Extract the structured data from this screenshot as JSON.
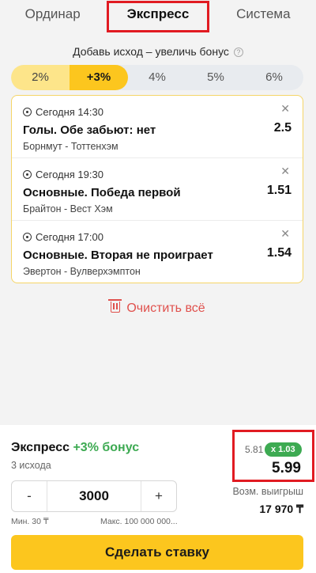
{
  "tabs": [
    "Ординар",
    "Экспресс",
    "Система"
  ],
  "bonus": {
    "title": "Добавь исход – увеличь бонус",
    "info_icon": "?",
    "steps": [
      "2%",
      "+3%",
      "4%",
      "5%",
      "6%"
    ]
  },
  "bets": [
    {
      "time": "Сегодня 14:30",
      "market": "Голы. Обе забьют: нет",
      "match": "Борнмут - Тоттенхэм",
      "odd": "2.5",
      "close": "✕"
    },
    {
      "time": "Сегодня 19:30",
      "market": "Основные. Победа первой",
      "match": "Брайтон - Вест Хэм",
      "odd": "1.51",
      "close": "✕"
    },
    {
      "time": "Сегодня 17:00",
      "market": "Основные. Вторая не проиграет",
      "match": "Эвертон - Вулверхэмптон",
      "odd": "1.54",
      "close": "✕"
    }
  ],
  "clear_all": "Очистить всё",
  "footer": {
    "title": "Экспресс",
    "bonus": "+3% бонус",
    "count": "3 исхода",
    "base_odd": "5.81",
    "boost": "x 1.03",
    "total_odd": "5.99",
    "stake": {
      "minus": "-",
      "value": "3000",
      "plus": "+"
    },
    "min_label": "Мин. 30 ₸",
    "max_label": "Макс. 100 000 000...",
    "win_label": "Возм. выигрыш",
    "win_value": "17 970 ₸",
    "place_button": "Сделать ставку"
  },
  "colors": {
    "accent": "#fcc61e",
    "accent_light": "#fde58a",
    "bonus_green": "#3daa52",
    "danger": "#e0514d",
    "highlight_box": "#e11b22"
  }
}
